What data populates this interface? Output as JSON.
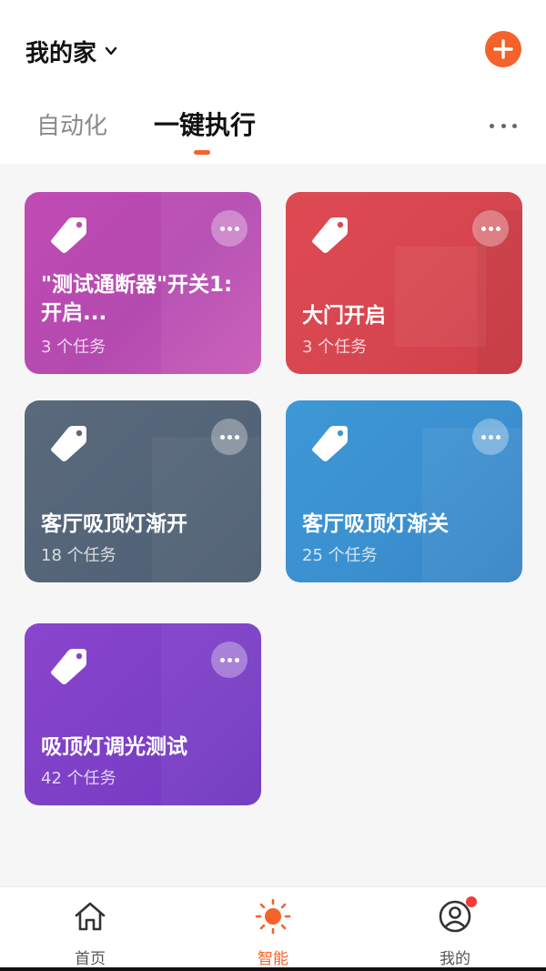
{
  "header": {
    "home_name": "我的家",
    "tabs": [
      {
        "label": "自动化",
        "active": false
      },
      {
        "label": "一键执行",
        "active": true
      }
    ]
  },
  "colors": {
    "accent": "#f3632a",
    "card_purple_pink": "#c04bb4",
    "card_red": "#de4a52",
    "card_slate": "#5a6a7c",
    "card_blue": "#3e98d6",
    "card_violet": "#8a45cc"
  },
  "scenes": [
    {
      "title": "\"测试通断器\"开关1:开启...",
      "count": "3 个任务"
    },
    {
      "title": "大门开启",
      "count": "3 个任务"
    },
    {
      "title": "客厅吸顶灯渐开",
      "count": "18 个任务"
    },
    {
      "title": "客厅吸顶灯渐关",
      "count": "25 个任务"
    },
    {
      "title": "吸顶灯调光测试",
      "count": "42 个任务"
    }
  ],
  "bottom_nav": [
    {
      "label": "首页",
      "icon": "home-icon",
      "active": false
    },
    {
      "label": "智能",
      "icon": "sun-icon",
      "active": true
    },
    {
      "label": "我的",
      "icon": "profile-icon",
      "active": false,
      "badge": true
    }
  ]
}
